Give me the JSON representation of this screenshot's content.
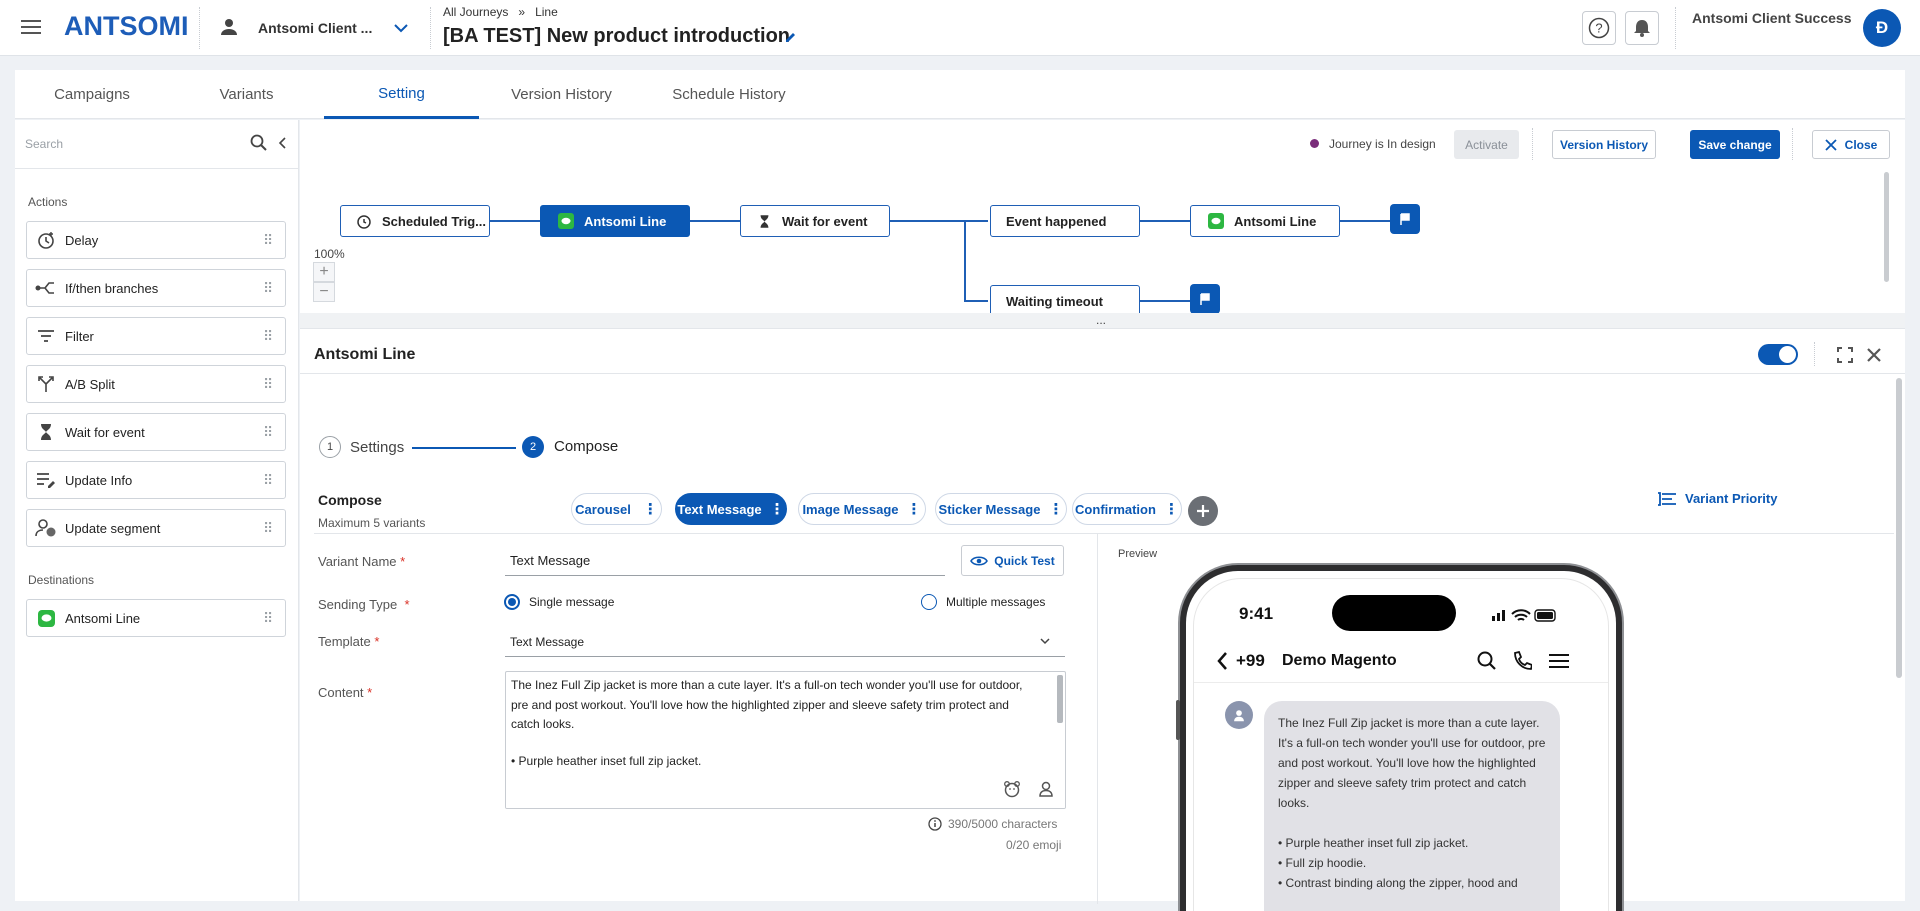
{
  "header": {
    "logo": "ANTSOMI",
    "account": "Antsomi Client ...",
    "breadcrumb": {
      "root": "All Journeys",
      "sep": "»",
      "current": "Line"
    },
    "title": "[BA TEST] New product introduction",
    "user_name": "Antsomi Client Success",
    "avatar_initial": "Đ"
  },
  "tabs": [
    {
      "label": "Campaigns"
    },
    {
      "label": "Variants"
    },
    {
      "label": "Setting"
    },
    {
      "label": "Version History"
    },
    {
      "label": "Schedule History"
    }
  ],
  "sidebar": {
    "search_placeholder": "Search",
    "actions_title": "Actions",
    "actions": [
      {
        "label": "Delay",
        "icon": "delay-clock-icon"
      },
      {
        "label": "If/then branches",
        "icon": "branches-icon"
      },
      {
        "label": "Filter",
        "icon": "filter-icon"
      },
      {
        "label": "A/B Split",
        "icon": "split-icon"
      },
      {
        "label": "Wait for event",
        "icon": "hourglass-icon"
      },
      {
        "label": "Update Info",
        "icon": "update-info-icon"
      },
      {
        "label": "Update segment",
        "icon": "segment-icon"
      }
    ],
    "destinations_title": "Destinations",
    "destinations": [
      {
        "label": "Antsomi Line",
        "icon": "line-app-icon"
      }
    ]
  },
  "toolbar": {
    "status": "Journey is In design",
    "activate": "Activate",
    "version_history": "Version History",
    "save": "Save change",
    "close": "Close"
  },
  "flow": {
    "zoom": "100%",
    "nodes": {
      "trigger": "Scheduled Trig...",
      "line1": "Antsomi Line",
      "wait": "Wait for event",
      "happened": "Event happened",
      "line2": "Antsomi Line",
      "timeout": "Waiting timeout"
    },
    "divider_dots": "..."
  },
  "panel": {
    "title": "Antsomi Line",
    "enabled": true,
    "steps": [
      {
        "num": "1",
        "label": "Settings"
      },
      {
        "num": "2",
        "label": "Compose"
      }
    ],
    "compose_title": "Compose",
    "compose_sub": "Maximum 5 variants",
    "variants": [
      {
        "label": "Carousel"
      },
      {
        "label": "Text Message"
      },
      {
        "label": "Image Message"
      },
      {
        "label": "Sticker Message"
      },
      {
        "label": "Confirmation"
      }
    ],
    "variant_priority": "Variant Priority",
    "form": {
      "variant_name_label": "Variant Name",
      "variant_name_value": "Text Message",
      "quick_test": "Quick Test",
      "sending_type_label": "Sending Type",
      "single": "Single message",
      "multiple": "Multiple messages",
      "template_label": "Template",
      "template_value": "Text Message",
      "content_label": "Content",
      "content_text_1": "The Inez Full Zip jacket is more than a cute layer. It's a full-on tech wonder you'll use for outdoor, pre and post workout. You'll love how the highlighted zipper and sleeve safety trim protect and catch looks.",
      "content_text_2": "• Purple heather inset full zip jacket.",
      "char_count": "390/5000 characters",
      "emoji_count": "0/20 emoji",
      "required_mark": "*"
    },
    "preview": {
      "label": "Preview",
      "time": "9:41",
      "contact": "+99",
      "chat_name": "Demo Magento",
      "msg_para": "The Inez Full Zip jacket is more than a cute layer. It's a full-on tech wonder you'll use for outdoor, pre and post workout. You'll love how the highlighted zipper and sleeve safety trim protect and catch looks.",
      "bullet_1": "• Purple heather inset full zip jacket.",
      "bullet_2": "• Full zip hoodie.",
      "bullet_3": "• Contrast binding along the zipper, hood and"
    }
  },
  "colors": {
    "primary": "#0b58b4",
    "line_green": "#2db742",
    "status_dot": "#7a2d7a"
  }
}
